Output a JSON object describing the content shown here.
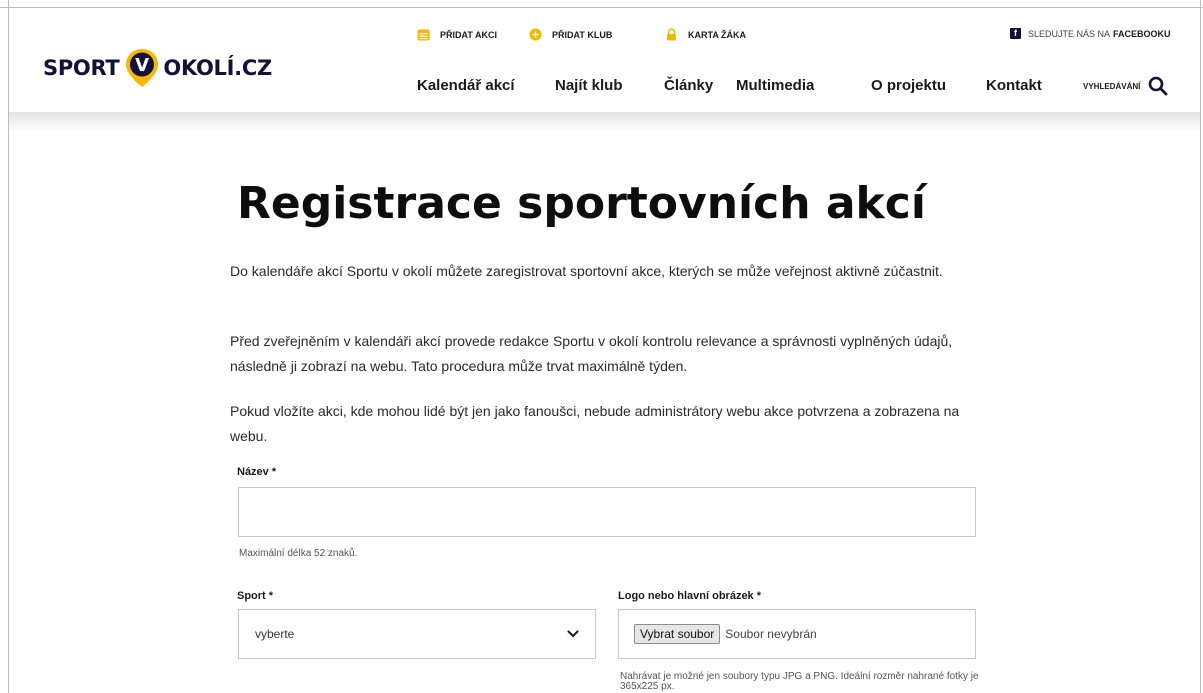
{
  "brand": {
    "left": "SPORT",
    "pin_letter": "V",
    "right": "OKOLÍ.CZ"
  },
  "topbar": {
    "add_event": "PŘIDAT AKCI",
    "add_club": "PŘIDAT KLUB",
    "student_card": "KARTA ŽÁKA",
    "facebook_prefix": "SLEDUJTE NÁS NA",
    "facebook_name": "FACEBOOKU"
  },
  "nav": {
    "items": [
      "Kalendář akcí",
      "Najít klub",
      "Články",
      "Multimedia",
      "O projektu",
      "Kontakt"
    ],
    "search_label": "VYHLEDÁVÁNÍ"
  },
  "icons": {
    "calendar": "calendar-icon",
    "club": "plus-circle-icon",
    "card": "lock-icon",
    "facebook": "facebook-icon",
    "search": "search-icon",
    "chevron": "chevron-down-icon"
  },
  "colors": {
    "accent": "#f5b800",
    "brand_navy": "#13113a"
  },
  "page": {
    "title": "Registrace sportovních akcí",
    "paragraphs": [
      "Do kalendáře akcí Sportu v okolí můžete zaregistrovat sportovní akce, kterých se může veřejnost aktivně zúčastnit.",
      "Před zveřejněním v kalendáři akcí provede redakce Sportu v okolí kontrolu relevance a správnosti vyplněných údajů, následně ji zobrazí na webu. Tato procedura může trvat maximálně týden.",
      "Pokud vložíte akci, kde mohou lidé být jen jako fanoušci, nebude administrátory webu akce potvrzena a zobrazena na webu."
    ]
  },
  "form": {
    "name_label": "Název *",
    "name_value": "",
    "name_hint": "Maximální délka 52 znaků.",
    "sport_label": "Sport *",
    "sport_selected": "vyberte",
    "logo_label": "Logo nebo hlavní obrázek *",
    "file_button": "Vybrat soubor",
    "file_status": "Soubor nevybrán",
    "logo_hint": "Nahrávat je možné jen soubory typu JPG a PNG. Ideální rozměr nahrané fotky je 365x225 px."
  }
}
